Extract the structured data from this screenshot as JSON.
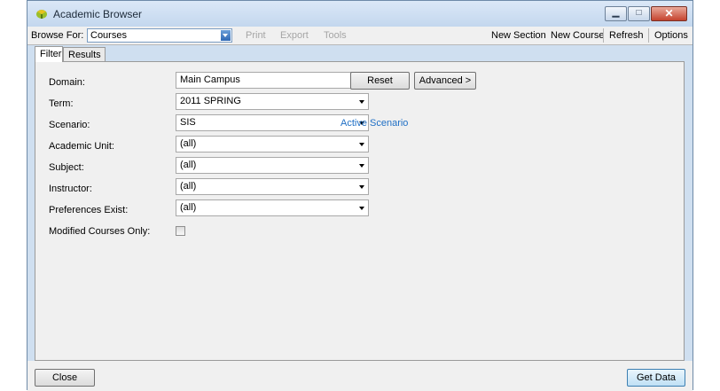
{
  "window": {
    "title": "Academic Browser"
  },
  "toolbar": {
    "browse_for_label": "Browse For:",
    "browse_for_value": "Courses",
    "print": "Print",
    "export": "Export",
    "tools": "Tools",
    "new_section": "New Section",
    "new_course": "New Course",
    "refresh": "Refresh",
    "options": "Options"
  },
  "tabs": [
    {
      "label": "Filter",
      "active": true
    },
    {
      "label": "Results",
      "active": false
    }
  ],
  "filter": {
    "domain": {
      "label": "Domain:",
      "value": "Main Campus"
    },
    "term": {
      "label": "Term:",
      "value": "2011 SPRING"
    },
    "scenario": {
      "label": "Scenario:",
      "value": "SIS"
    },
    "academic_unit": {
      "label": "Academic Unit:",
      "value": "(all)"
    },
    "subject": {
      "label": "Subject:",
      "value": "(all)"
    },
    "instructor": {
      "label": "Instructor:",
      "value": "(all)"
    },
    "preferences_exist": {
      "label": "Preferences Exist:",
      "value": "(all)"
    },
    "modified_only": {
      "label": "Modified Courses Only:",
      "checked": false
    },
    "reset": "Reset",
    "advanced": "Advanced >",
    "active_scenario_link": "Active Scenario"
  },
  "footer": {
    "close": "Close",
    "get_data": "Get Data"
  },
  "colors": {
    "link": "#1f6fc5",
    "close_button": "#c5432e",
    "titlebar": "#c3d7ee"
  }
}
